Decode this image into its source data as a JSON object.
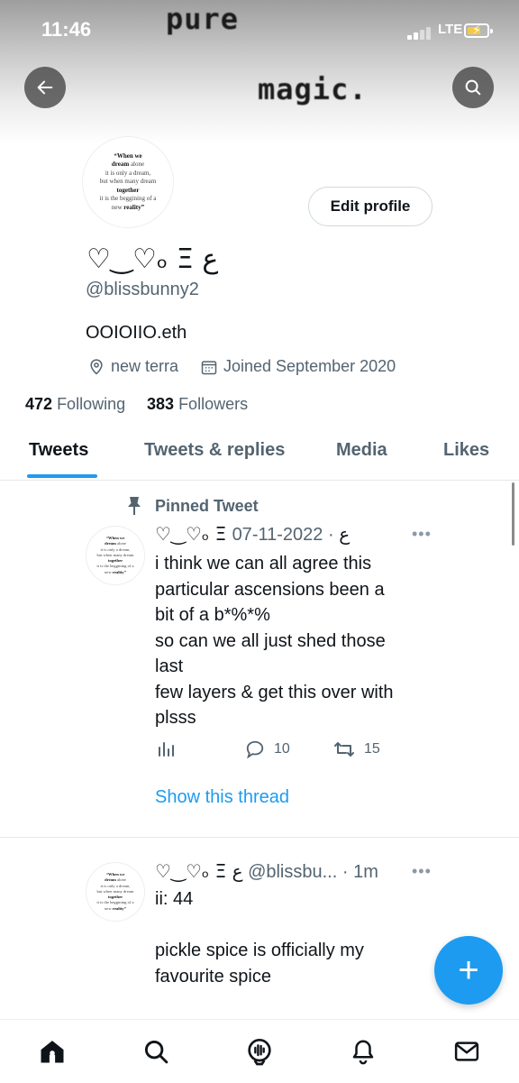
{
  "status_bar": {
    "time": "11:46",
    "network": "LTE"
  },
  "banner": {
    "line1": "pure",
    "line2": "magic."
  },
  "avatar_quote": {
    "line1": "“When we",
    "line2": "dream",
    "line3": "alone",
    "line4": "it is only a dream,",
    "line5": "but when many dream",
    "line6": "together",
    "line7": "it is the beggining of a",
    "line8": "new",
    "line9": "reality”"
  },
  "profile": {
    "edit_label": "Edit profile",
    "display_name": "♡‿♡ₒ Ξ ع",
    "handle": "@blissbunny2",
    "bio": "OOIOIIO.eth",
    "location": "new terra",
    "joined": "Joined September 2020",
    "following_count": "472",
    "following_label": "Following",
    "followers_count": "383",
    "followers_label": "Followers"
  },
  "tabs": [
    {
      "label": "Tweets"
    },
    {
      "label": "Tweets & replies"
    },
    {
      "label": "Media"
    },
    {
      "label": "Likes"
    }
  ],
  "tweets": [
    {
      "pinned_label": "Pinned Tweet",
      "name": "♡‿♡ₒ Ξ ع",
      "dot": "·",
      "date": "2022-11-07",
      "text": "i think we can all agree this\nparticular ascensions been a\nbit of a b*%*%\nso can we all just shed those\nlast\nfew layers & get this over with\nplsss",
      "replies": "10",
      "retweets": "15",
      "show_thread": "Show this thread"
    },
    {
      "name": "♡‿♡ₒ Ξ ع",
      "handle": "@blissbu...",
      "dot": "·",
      "date": "1m",
      "text": "ii: 44\n\npickle spice is officially my\nfavourite spice"
    }
  ],
  "fab_label": "+",
  "colors": {
    "accent": "#1d9bf0",
    "text": "#0f1419",
    "muted": "#536471"
  }
}
